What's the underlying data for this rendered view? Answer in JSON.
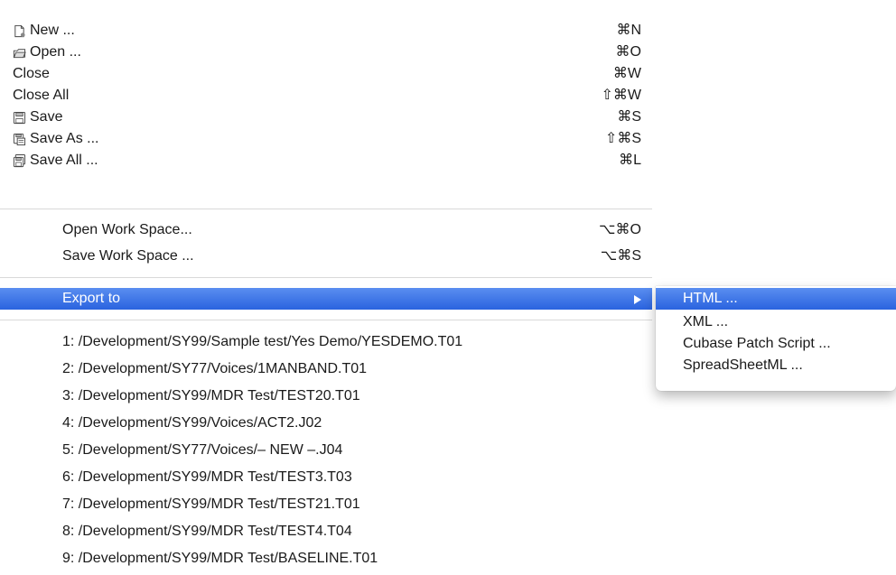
{
  "file_menu": {
    "new": {
      "label": "New ...",
      "shortcut": "⌘N",
      "icon": "new-document-icon"
    },
    "open": {
      "label": "Open ...",
      "shortcut": "⌘O",
      "icon": "open-folder-icon"
    },
    "close": {
      "label": "Close",
      "shortcut": "⌘W"
    },
    "close_all": {
      "label": "Close All",
      "shortcut": "⇧⌘W"
    },
    "save": {
      "label": "Save",
      "shortcut": "⌘S",
      "icon": "save-icon"
    },
    "save_as": {
      "label": "Save As ...",
      "shortcut": "⇧⌘S",
      "icon": "save-as-icon"
    },
    "save_all": {
      "label": "Save All ...",
      "shortcut": "⌘L",
      "icon": "save-all-icon"
    },
    "open_workspace": {
      "label": "Open Work Space...",
      "shortcut": "⌥⌘O"
    },
    "save_workspace": {
      "label": "Save Work Space ...",
      "shortcut": "⌥⌘S"
    },
    "export_to": {
      "label": "Export to",
      "has_submenu": true,
      "highlighted": true
    },
    "recent_files": [
      "1: /Development/SY99/Sample test/Yes Demo/YESDEMO.T01",
      "2: /Development/SY77/Voices/1MANBAND.T01",
      "3: /Development/SY99/MDR Test/TEST20.T01",
      "4: /Development/SY99/Voices/ACT2.J02",
      "5: /Development/SY77/Voices/– NEW –.J04",
      "6: /Development/SY99/MDR Test/TEST3.T03",
      "7: /Development/SY99/MDR Test/TEST21.T01",
      "8: /Development/SY99/MDR Test/TEST4.T04",
      "9: /Development/SY99/MDR Test/BASELINE.T01"
    ]
  },
  "export_submenu": {
    "items": [
      "HTML ...",
      "XML ...",
      "Cubase Patch Script ...",
      "SpreadSheetML ..."
    ],
    "highlighted_index": 0
  },
  "colors": {
    "highlight": "#2a63df",
    "highlight_text": "#ffffff",
    "text": "#1a1a1a",
    "separator": "#d9d9d9"
  }
}
